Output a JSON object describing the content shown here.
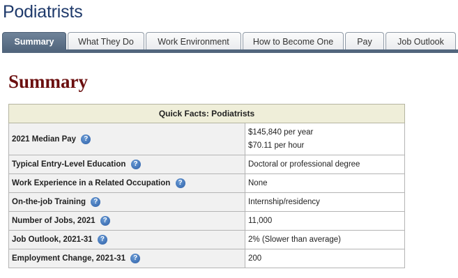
{
  "page": {
    "title": "Podiatrists"
  },
  "tabs": [
    {
      "label": "Summary",
      "active": true
    },
    {
      "label": "What They Do",
      "active": false
    },
    {
      "label": "Work Environment",
      "active": false
    },
    {
      "label": "How to Become One",
      "active": false
    },
    {
      "label": "Pay",
      "active": false
    },
    {
      "label": "Job Outlook",
      "active": false
    }
  ],
  "section": {
    "heading": "Summary"
  },
  "quick_facts": {
    "header": "Quick Facts: Podiatrists",
    "help_icon": "?",
    "rows": [
      {
        "label": "2021 Median Pay",
        "values": [
          "$145,840 per year",
          "$70.11 per hour"
        ]
      },
      {
        "label": "Typical Entry-Level Education",
        "values": [
          "Doctoral or professional degree"
        ]
      },
      {
        "label": "Work Experience in a Related Occupation",
        "values": [
          "None"
        ]
      },
      {
        "label": "On-the-job Training",
        "values": [
          "Internship/residency"
        ]
      },
      {
        "label": "Number of Jobs, 2021",
        "values": [
          "11,000"
        ]
      },
      {
        "label": "Job Outlook, 2021-31",
        "values": [
          "2% (Slower than average)"
        ]
      },
      {
        "label": "Employment Change, 2021-31",
        "values": [
          "200"
        ]
      }
    ]
  },
  "colors": {
    "title": "#1f3a6b",
    "active_tab": "#52667d",
    "section_heading": "#6b0f0f",
    "table_header_bg": "#efeed9",
    "help_icon": "#2c5ea6"
  },
  "icons": {
    "help": "question-circle-icon"
  }
}
